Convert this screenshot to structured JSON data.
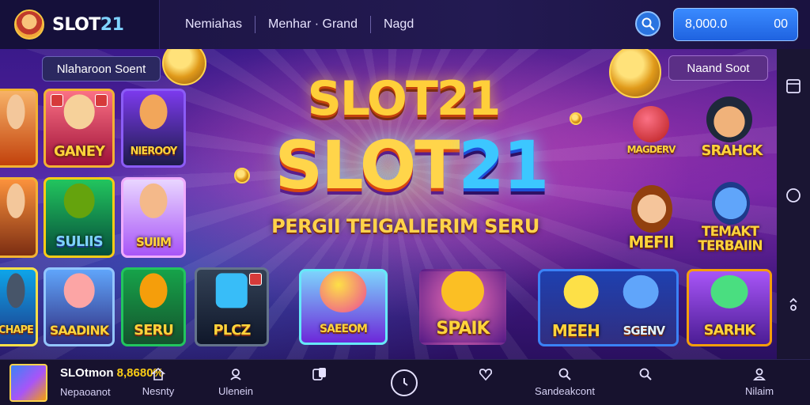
{
  "brand": {
    "name_prefix": "SLOT",
    "name_suffix": "21"
  },
  "nav": [
    "Nemiahas",
    "Menhar · Grand",
    "Nagd"
  ],
  "header": {
    "balance_amount": "8,000.0",
    "balance_currency": "00"
  },
  "banner": {
    "tag_left": "Nlaharoon Soent",
    "tag_right": "Naand Soot",
    "title_line1": "SLOT21",
    "title_line2_prefix": "SLOT",
    "title_line2_suffix": "21",
    "subtitle": "PERGII TEIGALIERIM SERU"
  },
  "games": [
    {
      "label": ""
    },
    {
      "label": "GANEY"
    },
    {
      "label": "NIEROOY"
    },
    {
      "label": ""
    },
    {
      "label": "SULIIS"
    },
    {
      "label": "SUIIM"
    },
    {
      "label": "SAADINK"
    },
    {
      "label": "SERU"
    },
    {
      "label": "PLCZ"
    },
    {
      "label": "SAEEOM"
    },
    {
      "label": "SPAIK"
    },
    {
      "label": "MEEH"
    },
    {
      "label": "SGENV"
    },
    {
      "label": "SARHK"
    },
    {
      "label": "MAGDERV"
    },
    {
      "label": "SRAHCK"
    },
    {
      "label": "MEFII"
    },
    {
      "label": "TEMAKT TERBAIIN"
    },
    {
      "label": "CHAPE"
    }
  ],
  "bottom": {
    "now_title": "SLOtmon",
    "now_amount": "8,8680%",
    "now_sub": "Nepaoanot",
    "items": [
      "Nesnty",
      "Ulenein",
      "",
      "",
      "Sandeakcont",
      "",
      "Nilaim"
    ]
  },
  "colors": {
    "accent_blue": "#2a74e0",
    "gold": "#ffd43b",
    "bg_dark": "#140a2e"
  }
}
